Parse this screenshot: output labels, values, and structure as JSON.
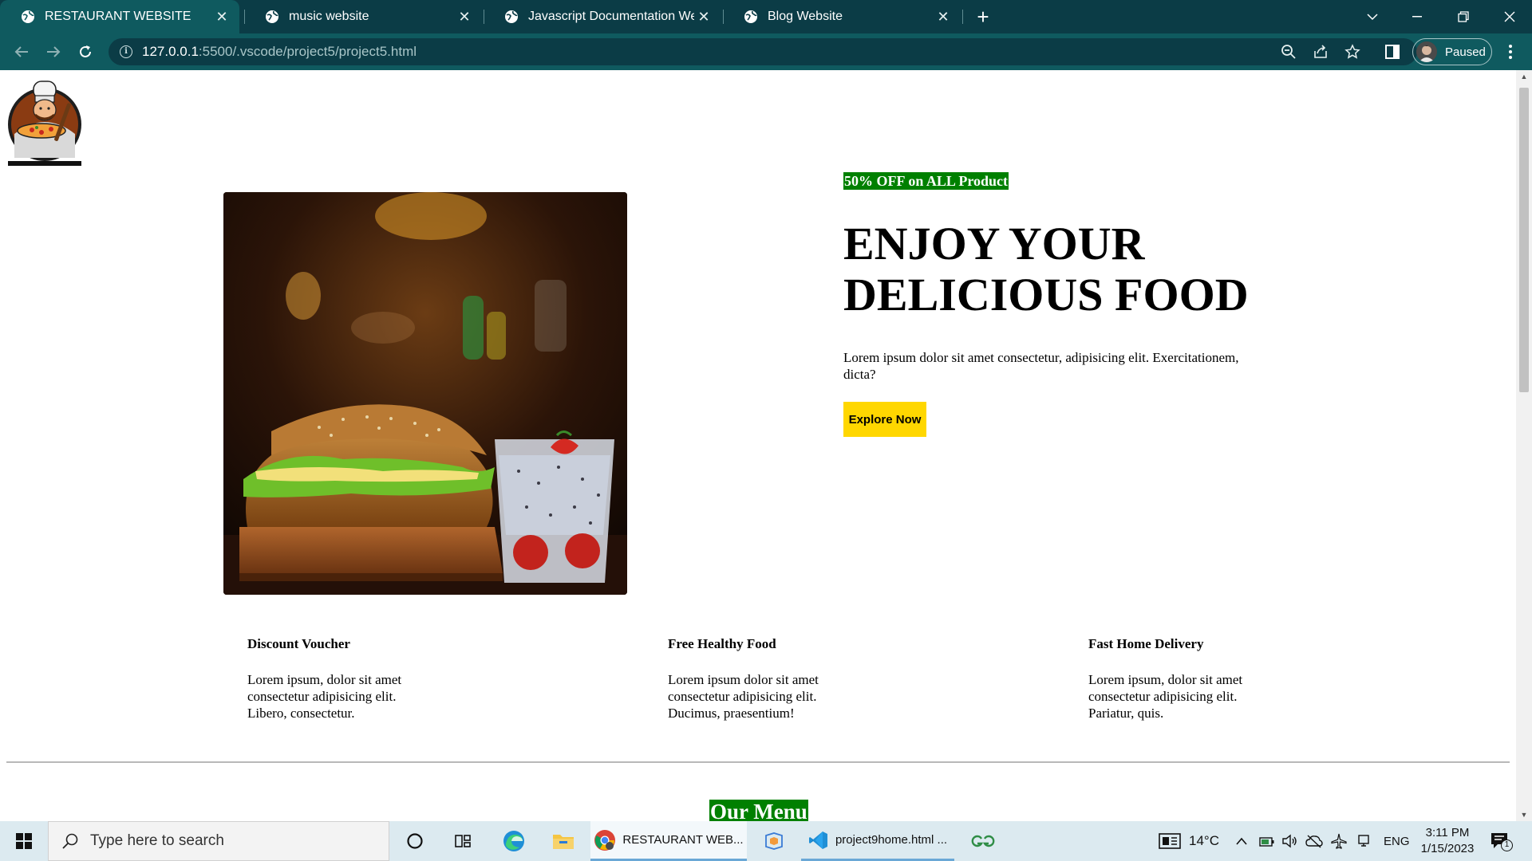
{
  "browser": {
    "tabs": [
      {
        "title": "RESTAURANT WEBSITE",
        "active": true
      },
      {
        "title": "music website",
        "active": false
      },
      {
        "title": "Javascript Documentation Website",
        "active": false
      },
      {
        "title": "Blog Website",
        "active": false
      }
    ],
    "new_tab_label": "+",
    "url_host": "127.0.0.1",
    "url_path": ":5500/.vscode/project5/project5.html",
    "profile_status": "Paused"
  },
  "page": {
    "promo_badge": "50% OFF on ALL Product",
    "hero_title_line1": "ENJOY YOUR",
    "hero_title_line2": "DELICIOUS FOOD",
    "hero_text": "Lorem ipsum dolor sit amet consectetur, adipisicing elit. Exercitationem, dicta?",
    "cta_label": "Explore Now",
    "features": [
      {
        "title": "Discount Voucher",
        "text": "Lorem ipsum, dolor sit amet consectetur adipisicing elit. Libero, consectetur."
      },
      {
        "title": "Free Healthy Food",
        "text": "Lorem ipsum dolor sit amet consectetur adipisicing elit. Ducimus, praesentium!"
      },
      {
        "title": "Fast Home Delivery",
        "text": "Lorem ipsum, dolor sit amet consectetur adipisicing elit. Pariatur, quis."
      }
    ],
    "menu_heading": "Our Menu"
  },
  "taskbar": {
    "search_placeholder": "Type here to search",
    "apps": [
      {
        "label": "RESTAURANT WEB...",
        "icon": "chrome-icon"
      },
      {
        "label": "project9home.html ...",
        "icon": "vscode-icon"
      }
    ],
    "weather": "14°C",
    "language": "ENG",
    "time": "3:11 PM",
    "date": "1/15/2023",
    "notification_count": "1"
  },
  "colors": {
    "tab_bar": "#0b3c46",
    "toolbar": "#0f5a5f",
    "promo_bg": "#008000",
    "cta_bg": "#ffd700"
  }
}
